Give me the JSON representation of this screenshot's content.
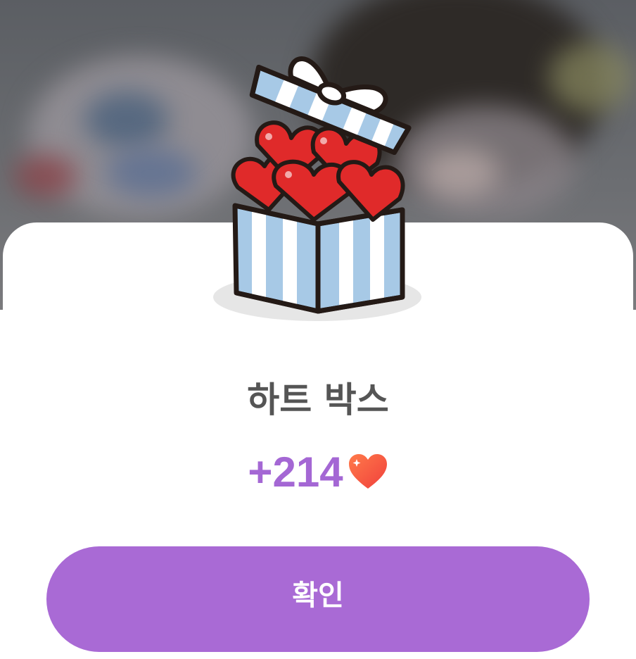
{
  "dialog": {
    "title": "하트 박스",
    "amount": "+214",
    "amount_icon": "heart-icon",
    "confirm_label": "확인"
  },
  "colors": {
    "accent": "#a96ad5",
    "amount_text": "#a467d4",
    "title_text": "#555555",
    "gift_box": "#a7c9e6",
    "hearts": "#e02a2a"
  }
}
